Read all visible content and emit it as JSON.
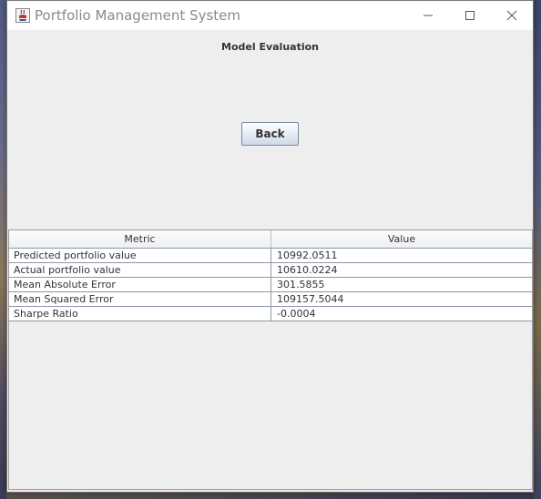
{
  "window": {
    "title": "Portfolio Management System",
    "app_icon": "java-coffee-cup-icon",
    "controls": [
      "minimize-icon",
      "maximize-icon",
      "close-icon"
    ]
  },
  "page": {
    "heading": "Model Evaluation",
    "back_label": "Back"
  },
  "table": {
    "columns": [
      "Metric",
      "Value"
    ],
    "rows": [
      {
        "metric": "Predicted portfolio value",
        "value": "10992.0511"
      },
      {
        "metric": "Actual portfolio value",
        "value": "10610.0224"
      },
      {
        "metric": "Mean Absolute Error",
        "value": "301.5855"
      },
      {
        "metric": "Mean Squared Error",
        "value": "109157.5044"
      },
      {
        "metric": "Sharpe Ratio",
        "value": "-0.0004"
      }
    ]
  },
  "colors": {
    "window_background": "#eeeeee",
    "titlebar_background": "#ffffff",
    "table_grid": "#8c97a8",
    "button_border": "#7a8aa0"
  }
}
